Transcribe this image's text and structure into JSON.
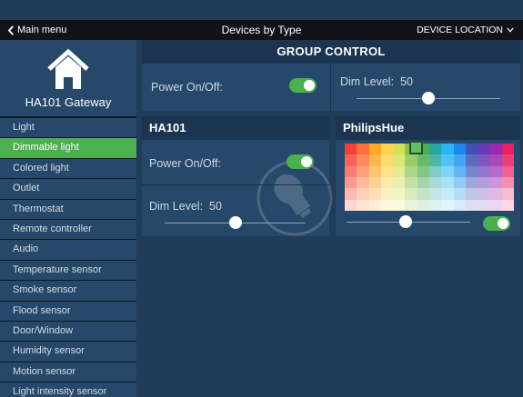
{
  "header": {
    "back_label": "Main menu",
    "title": "Devices by Type",
    "location_label": "DEVICE LOCATION"
  },
  "sidebar": {
    "gateway_name": "HA101 Gateway",
    "items": [
      {
        "label": "Light",
        "active": false
      },
      {
        "label": "Dimmable light",
        "active": true
      },
      {
        "label": "Colored light",
        "active": false
      },
      {
        "label": "Outlet",
        "active": false
      },
      {
        "label": "Thermostat",
        "active": false
      },
      {
        "label": "Remote controller",
        "active": false
      },
      {
        "label": "Audio",
        "active": false
      },
      {
        "label": "Temperature sensor",
        "active": false
      },
      {
        "label": "Smoke sensor",
        "active": false
      },
      {
        "label": "Flood sensor",
        "active": false
      },
      {
        "label": "Door/Window",
        "active": false
      },
      {
        "label": "Humidity sensor",
        "active": false
      },
      {
        "label": "Motion sensor",
        "active": false
      },
      {
        "label": "Light intensity sensor",
        "active": false
      }
    ]
  },
  "group_control": {
    "title": "GROUP CONTROL",
    "power_label": "Power On/Off:",
    "power_on": true,
    "dim_label": "Dim Level:",
    "dim_value": "50",
    "dim_fraction": 0.5
  },
  "ha101": {
    "title": "HA101",
    "power_label": "Power On/Off:",
    "power_on": true,
    "dim_label": "Dim Level:",
    "dim_value": "50",
    "dim_fraction": 0.5
  },
  "philips_hue": {
    "title": "PhilipsHue",
    "brightness_fraction": 0.48,
    "power_on": true,
    "selected_color": {
      "row": 0,
      "col": 5
    },
    "palette": [
      [
        "#f44336",
        "#ff6d3f",
        "#ffa726",
        "#ffd24d",
        "#d4e157",
        "#8bc34a",
        "#4caf50",
        "#26a69a",
        "#29b6f6",
        "#1e88e5",
        "#3f51b5",
        "#673ab7",
        "#9c27b0",
        "#e91e63"
      ],
      [
        "#f5645a",
        "#ff8a5c",
        "#ffb74d",
        "#ffdb6e",
        "#dce775",
        "#9ccc65",
        "#66bb6a",
        "#4db6ac",
        "#4fc3f7",
        "#42a5f5",
        "#5c6bc0",
        "#7e57c2",
        "#ab47bc",
        "#ec407a"
      ],
      [
        "#f77f77",
        "#ffa07a",
        "#ffc670",
        "#ffe38b",
        "#e3ec8f",
        "#aed581",
        "#81c784",
        "#80cbc4",
        "#81d4fa",
        "#64b5f6",
        "#7986cb",
        "#9575cd",
        "#ba68c8",
        "#f06292"
      ],
      [
        "#f99a94",
        "#ffb899",
        "#ffd294",
        "#ffeaa8",
        "#eaf1aa",
        "#c5e1a5",
        "#a5d6a7",
        "#a7dcd6",
        "#a9e0f8",
        "#90caf9",
        "#9fa8da",
        "#b39ddb",
        "#ce93d8",
        "#f48fb1"
      ],
      [
        "#fbb7b2",
        "#ffcfb8",
        "#ffdfb5",
        "#fff0c4",
        "#f0f5c4",
        "#d7eac0",
        "#c4e4c5",
        "#c4e8e3",
        "#c8ebfa",
        "#b6dcfb",
        "#c0c6e6",
        "#cdbfe8",
        "#dfb8e6",
        "#f8bcd0"
      ],
      [
        "#fdd6d3",
        "#ffe4d6",
        "#ffeed6",
        "#fff7e0",
        "#f7fae0",
        "#e9f3dc",
        "#def0df",
        "#dcf2ef",
        "#e1f5fd",
        "#d6ebfd",
        "#dde0f2",
        "#e4dbf3",
        "#eed6f2",
        "#fbd9e5"
      ]
    ]
  }
}
